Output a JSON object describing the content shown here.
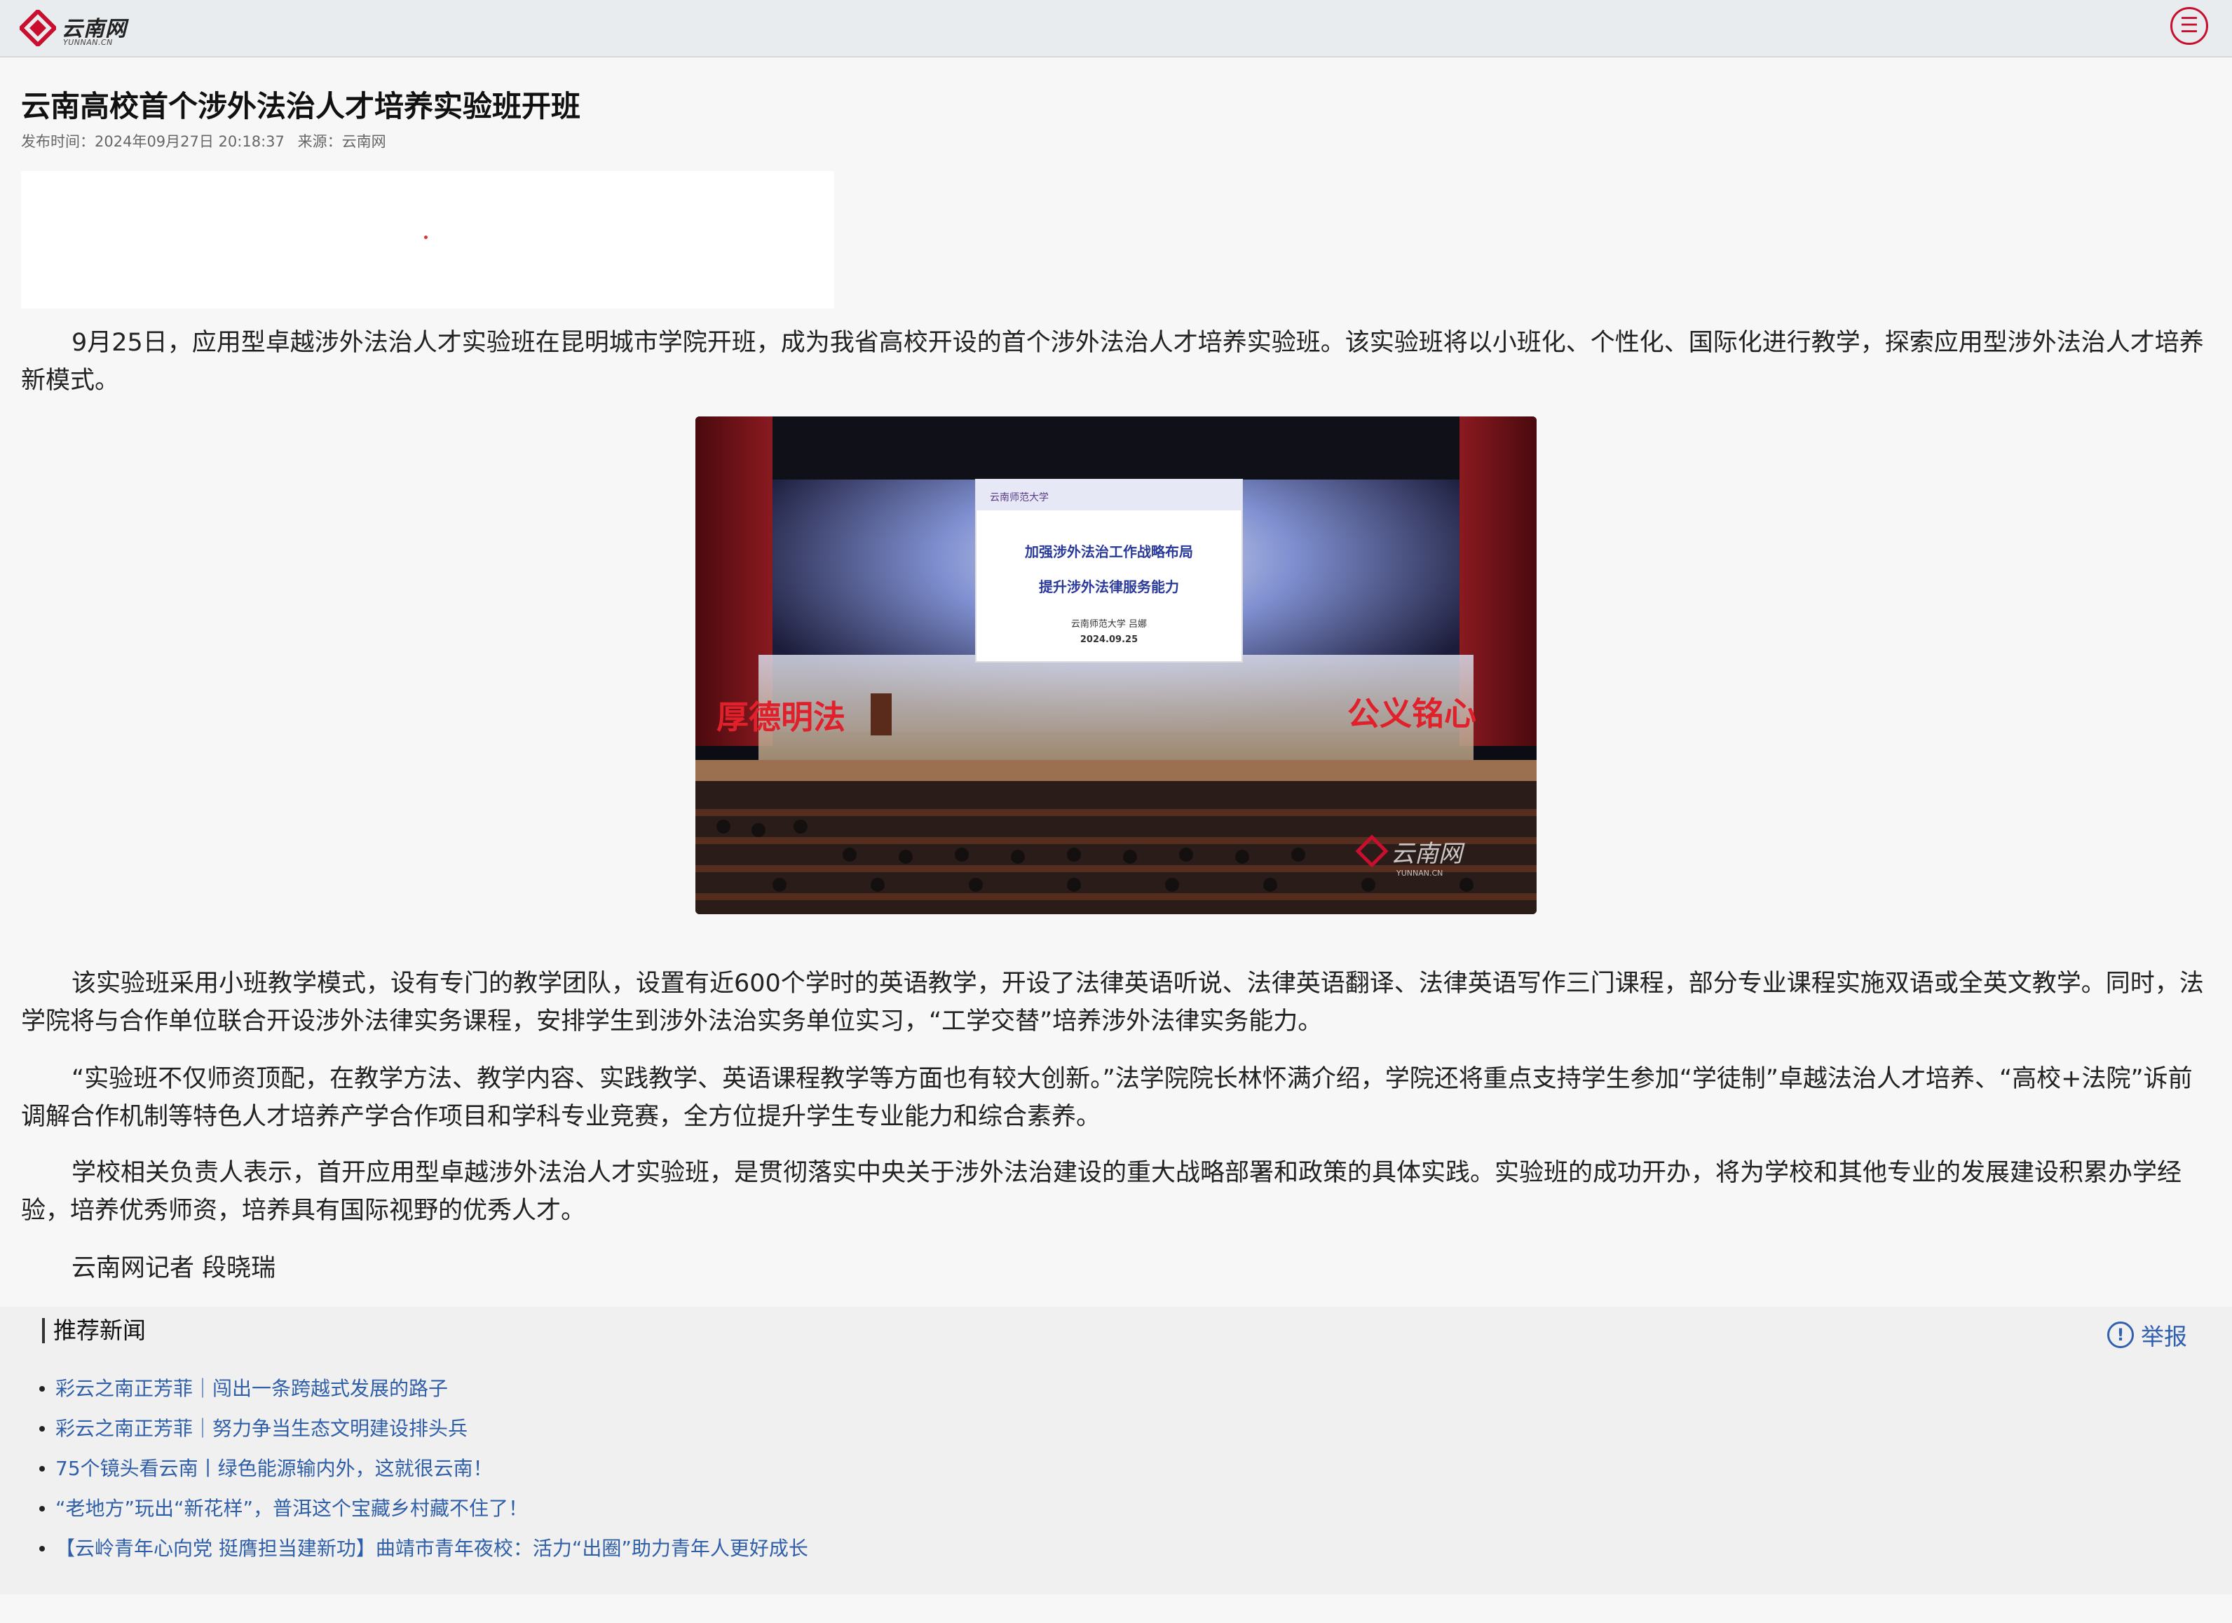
{
  "header": {
    "logo_text": "云南网",
    "logo_sub": "YUNNAN.CN",
    "menu_icon": "menu-icon"
  },
  "article": {
    "title": "云南高校首个涉外法治人才培养实验班开班",
    "publish_label": "发布时间：2024年09月27日 20:18:37",
    "source_label": "来源：云南网",
    "paragraphs": [
      "9月25日，应用型卓越涉外法治人才实验班在昆明城市学院开班，成为我省高校开设的首个涉外法治人才培养实验班。该实验班将以小班化、个性化、国际化进行教学，探索应用型涉外法治人才培养新模式。",
      "该实验班采用小班教学模式，设有专门的教学团队，设置有近600个学时的英语教学，开设了法律英语听说、法律英语翻译、法律英语写作三门课程，部分专业课程实施双语或全英文教学。同时，法学院将与合作单位联合开设涉外法律实务课程，安排学生到涉外法治实务单位实习，“工学交替”培养涉外法律实务能力。",
      "“实验班不仅师资顶配，在教学方法、教学内容、实践教学、英语课程教学等方面也有较大创新。”法学院院长林怀满介绍，学院还将重点支持学生参加“学徒制”卓越法治人才培养、“高校+法院”诉前调解合作机制等特色人才培养产学合作项目和学科专业竞赛，全方位提升学生专业能力和综合素养。",
      "学校相关负责人表示，首开应用型卓越涉外法治人才实验班，是贯彻落实中央关于涉外法治建设的重大战略部署和政策的具体实践。实验班的成功开办，将为学校和其他专业的发展建设积累办学经验，培养优秀师资，培养具有国际视野的优秀人才。",
      "云南网记者 段晓瑞"
    ]
  },
  "photo": {
    "screen_logo": "云南师范大学",
    "screen_line1": "加强涉外法治工作战略布局",
    "screen_line2": "提升涉外法律服务能力",
    "screen_line3": "云南师范大学 吕娜",
    "screen_date": "2024.09.25",
    "stage_left": "厚德明法",
    "stage_right": "公义铭心",
    "watermark": "云南网",
    "watermark_sub": "YUNNAN.CN"
  },
  "recommend": {
    "heading": "推荐新闻",
    "report_label": "举报",
    "items": [
      "彩云之南正芳菲｜闯出一条跨越式发展的路子",
      "彩云之南正芳菲｜努力争当生态文明建设排头兵",
      "75个镜头看云南丨绿色能源输内外，这就很云南！",
      "“老地方”玩出“新花样”，普洱这个宝藏乡村藏不住了！",
      "【云岭青年心向党 挺膺担当建新功】曲靖市青年夜校：活力“出圈”助力青年人更好成长"
    ]
  },
  "colors": {
    "brand_red": "#c8102e",
    "link_blue": "#2f5fa8",
    "header_bg": "#e9ecef"
  }
}
